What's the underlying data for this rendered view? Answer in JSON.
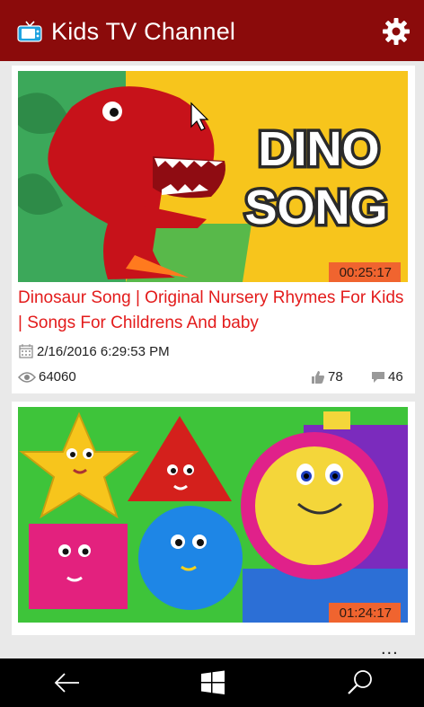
{
  "header": {
    "title": "Kids TV Channel",
    "icons": {
      "app": "tv-icon",
      "settings": "gear-icon"
    }
  },
  "videos": [
    {
      "thumbnail_text": [
        "DINO",
        "SONG"
      ],
      "duration": "00:25:17",
      "title": "Dinosaur Song | Original Nursery Rhymes For Kids |  Songs For Childrens And baby",
      "date": "2/16/2016 6:29:53 PM",
      "views": "64060",
      "likes": "78",
      "comments": "46"
    },
    {
      "duration": "01:24:17"
    }
  ],
  "appbar": {
    "more": "..."
  },
  "navbar": {
    "icons": [
      "back-arrow-icon",
      "windows-start-icon",
      "search-icon"
    ]
  },
  "colors": {
    "header_bg": "#8b0b0b",
    "title_red": "#e31b1b",
    "duration_bg": "#f0642f"
  }
}
